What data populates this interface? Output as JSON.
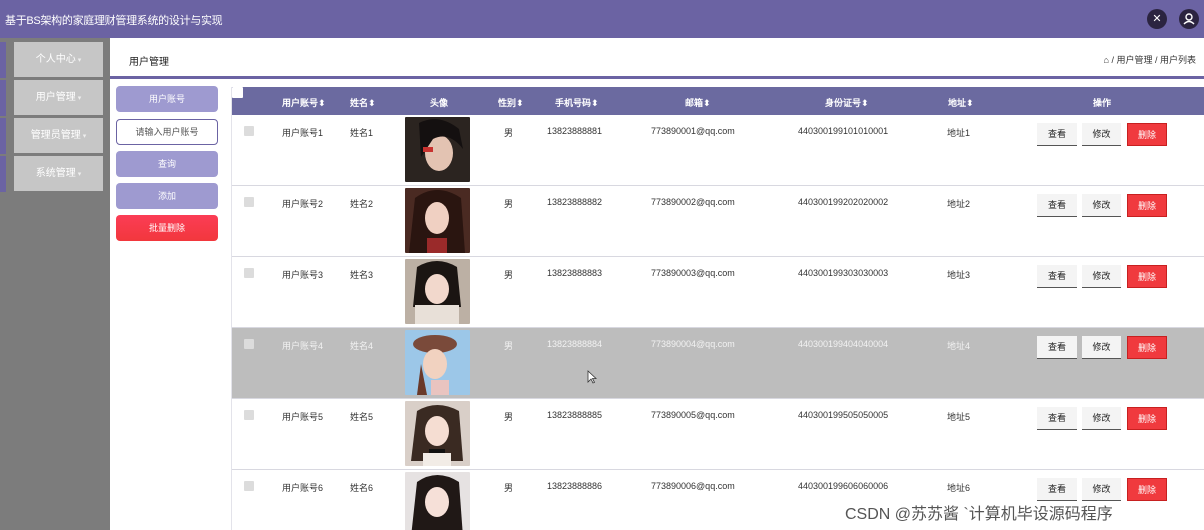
{
  "app": {
    "title": "基于BS架构的家庭理财管理系统的设计与实现",
    "icons": [
      "expand-icon",
      "user-icon"
    ]
  },
  "sidebar": {
    "items": [
      {
        "label": "个人中心"
      },
      {
        "label": "用户管理"
      },
      {
        "label": "管理员管理"
      },
      {
        "label": "系统管理"
      }
    ],
    "caret": "▾"
  },
  "header": {
    "page_title": "用户管理",
    "breadcrumb": "/ 用户管理 / 用户列表",
    "home_icon": "⌂"
  },
  "search": {
    "field_label": "用户账号",
    "placeholder": "请输入用户账号",
    "query_label": "查询",
    "add_label": "添加",
    "batch_delete_label": "批量删除"
  },
  "table": {
    "columns": [
      "用户账号",
      "姓名",
      "头像",
      "性别",
      "手机号码",
      "邮箱",
      "身份证号",
      "地址",
      "操作"
    ],
    "sort_marker": "⬍",
    "actions": {
      "view": "查看",
      "edit": "修改",
      "delete": "删除"
    },
    "rows": [
      {
        "account": "用户账号1",
        "name": "姓名1",
        "gender": "男",
        "phone": "13823888881",
        "email": "773890001@qq.com",
        "id_card": "440300199101010001",
        "address": "地址1"
      },
      {
        "account": "用户账号2",
        "name": "姓名2",
        "gender": "男",
        "phone": "13823888882",
        "email": "773890002@qq.com",
        "id_card": "440300199202020002",
        "address": "地址2"
      },
      {
        "account": "用户账号3",
        "name": "姓名3",
        "gender": "男",
        "phone": "13823888883",
        "email": "773890003@qq.com",
        "id_card": "440300199303030003",
        "address": "地址3"
      },
      {
        "account": "用户账号4",
        "name": "姓名4",
        "gender": "男",
        "phone": "13823888884",
        "email": "773890004@qq.com",
        "id_card": "440300199404040004",
        "address": "地址4"
      },
      {
        "account": "用户账号5",
        "name": "姓名5",
        "gender": "男",
        "phone": "13823888885",
        "email": "773890005@qq.com",
        "id_card": "440300199505050005",
        "address": "地址5"
      },
      {
        "account": "用户账号6",
        "name": "姓名6",
        "gender": "男",
        "phone": "13823888886",
        "email": "773890006@qq.com",
        "id_card": "440300199606060006",
        "address": "地址6"
      }
    ]
  },
  "watermark": "CSDN @苏苏酱    `计算机毕设源码程序",
  "colors": {
    "primary": "#6b63a3",
    "header": "#6b6aa0",
    "danger": "#f03a3e",
    "sidebar": "#7c7c7c"
  }
}
